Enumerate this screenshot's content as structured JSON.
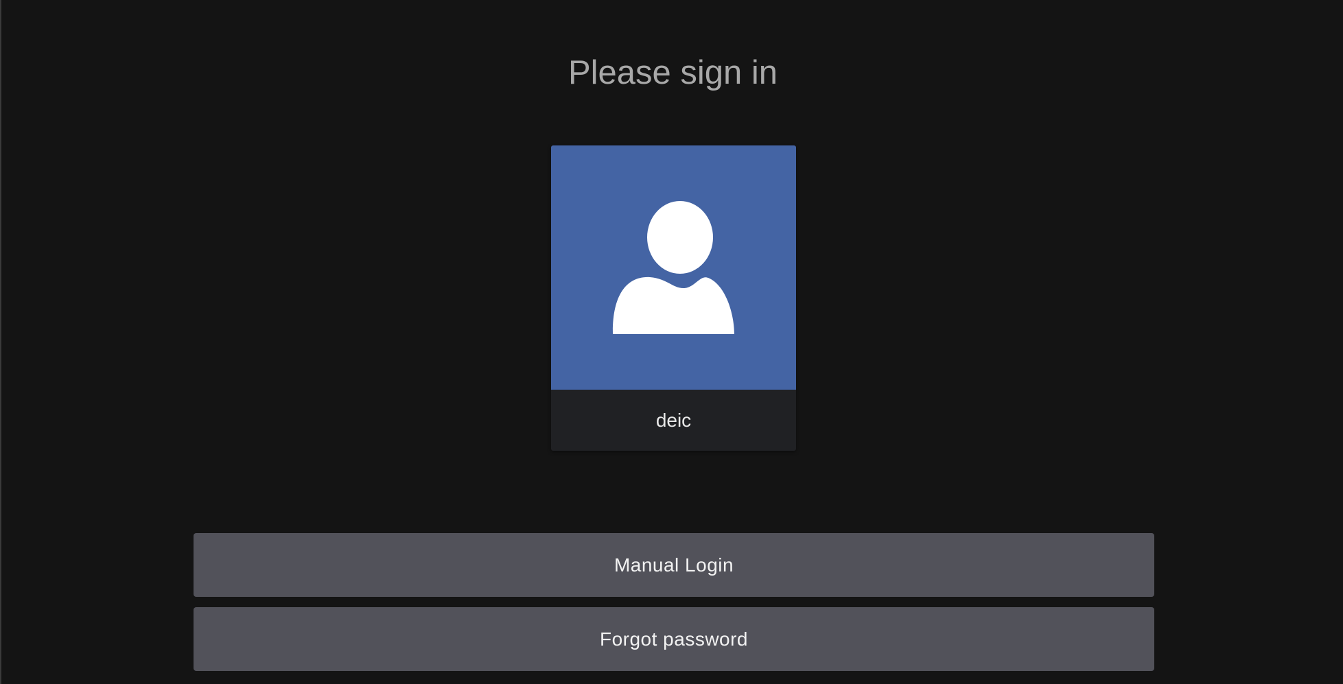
{
  "heading": "Please sign in",
  "users": [
    {
      "name": "deic",
      "avatar_icon": "user-silhouette-icon",
      "avatar_bg": "#4464a4"
    }
  ],
  "buttons": {
    "manual_login": "Manual Login",
    "forgot_password": "Forgot password"
  },
  "colors": {
    "background": "#141414",
    "button_bg": "#52525a",
    "card_name_bg": "#202124",
    "heading_text": "#a8a8a8"
  }
}
